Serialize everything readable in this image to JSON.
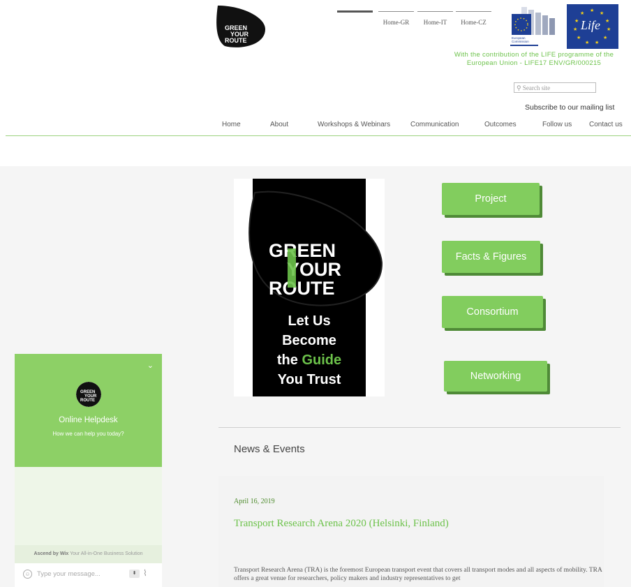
{
  "header": {
    "logo_text": [
      "GREEN",
      "YOUR",
      "ROUTE"
    ],
    "lang_tabs": [
      "",
      "Home-GR",
      "Home-IT",
      "Home-CZ"
    ],
    "ec_label": [
      "European",
      "Commission"
    ],
    "life_label": "Life",
    "contribution": "With the contribution of the LIFE programme of the European Union - LIFE17 ENV/GR/000215",
    "search_placeholder": "Search site",
    "subscribe": "Subscribe to our mailing list"
  },
  "nav": [
    "Home",
    "About",
    "Workshops & Webinars",
    "Communication",
    "Outcomes",
    "Follow us",
    "Contact us"
  ],
  "hero": {
    "logo_text": [
      "GREEN",
      "YOUR",
      "ROUTE"
    ],
    "tagline": [
      "Let Us",
      "Become",
      "the ",
      "Guide",
      "You Trust"
    ]
  },
  "buttons": [
    "Project",
    "Facts & Figures",
    "Consortium",
    "Networking"
  ],
  "news": {
    "section_title": "News & Events",
    "date": "April 16, 2019",
    "headline": "Transport Research Arena 2020 (Helsinki, Finland)",
    "body": "Transport Research Arena (TRA) is the foremost European transport event that covers all transport modes and all aspects of mobility. TRA offers a great venue for researchers, policy makers and industry representatives to get"
  },
  "chat": {
    "logo_text": [
      "GREEN",
      "YOUR",
      "ROUTE"
    ],
    "title": "Online Helpdesk",
    "subtitle": "How we can help you today?",
    "ascend_brand": "Ascend by Wix",
    "ascend_tagline": "Your All-in-One Business Solution",
    "input_placeholder": "Type your message..."
  },
  "colors": {
    "accent": "#82cd5e",
    "accent_shadow": "#4f8a37",
    "brand_green": "#6cc24a",
    "eu_blue": "#1e3f95"
  }
}
